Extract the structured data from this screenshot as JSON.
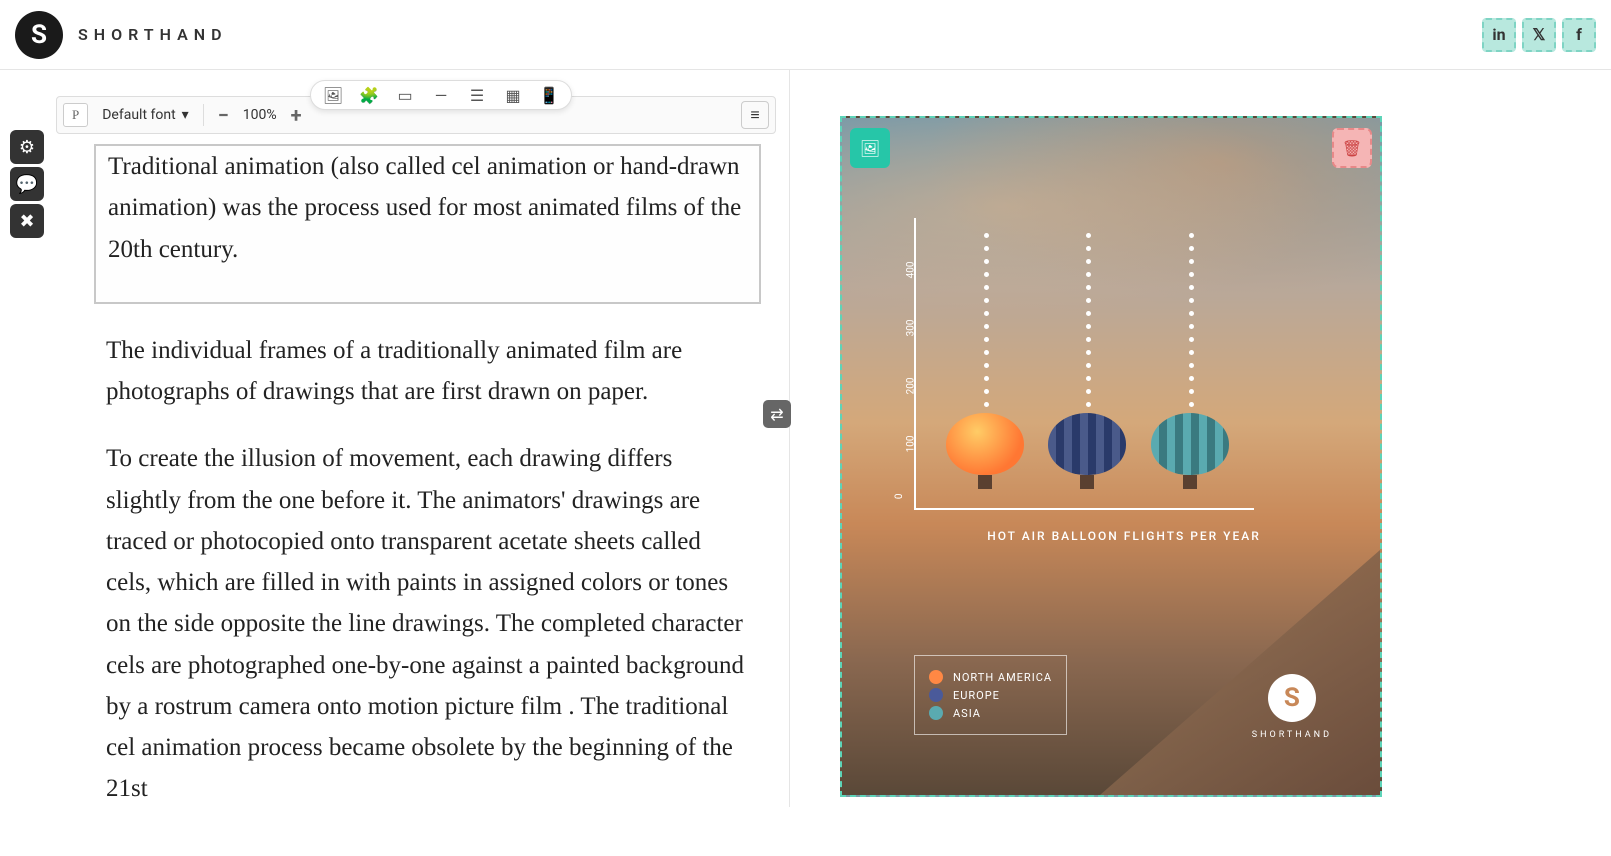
{
  "brand": {
    "initial": "S",
    "name": "SHORTHAND"
  },
  "social": {
    "linkedin": "in",
    "x": "𝕏",
    "facebook": "f"
  },
  "toolbar": {
    "tag": "P",
    "font_label": "Default font",
    "zoom": "100%"
  },
  "content": {
    "p1": "Traditional animation (also called cel animation or hand-drawn animation) was the process used for most animated films of the 20th century.",
    "p2": "The individual frames of a traditionally animated film are photographs of drawings that are first drawn on paper.",
    "p3": "To create the illusion of movement, each drawing differs slightly from the one before it. The animators' drawings are traced or photocopied onto transparent acetate sheets called cels, which are filled in with paints in assigned colors or tones on the side opposite the line drawings. The completed character cels are photographed one-by-one against a painted background by a rostrum camera onto motion picture film . The traditional cel animation process became obsolete by the beginning of the 21st"
  },
  "chart_data": {
    "type": "bar",
    "title": "HOT AIR BALLOON FLIGHTS PER YEAR",
    "ylabel": "",
    "ylim": [
      0,
      400
    ],
    "y_ticks": [
      "0",
      "100",
      "200",
      "300",
      "400"
    ],
    "categories": [
      "North America",
      "Europe",
      "Asia"
    ],
    "values": [
      110,
      110,
      110
    ]
  },
  "legend": {
    "items": [
      {
        "label": "NORTH AMERICA"
      },
      {
        "label": "EUROPE"
      },
      {
        "label": "ASIA"
      }
    ]
  },
  "brand_mark": {
    "initial": "S",
    "name": "SHORTHAND"
  }
}
